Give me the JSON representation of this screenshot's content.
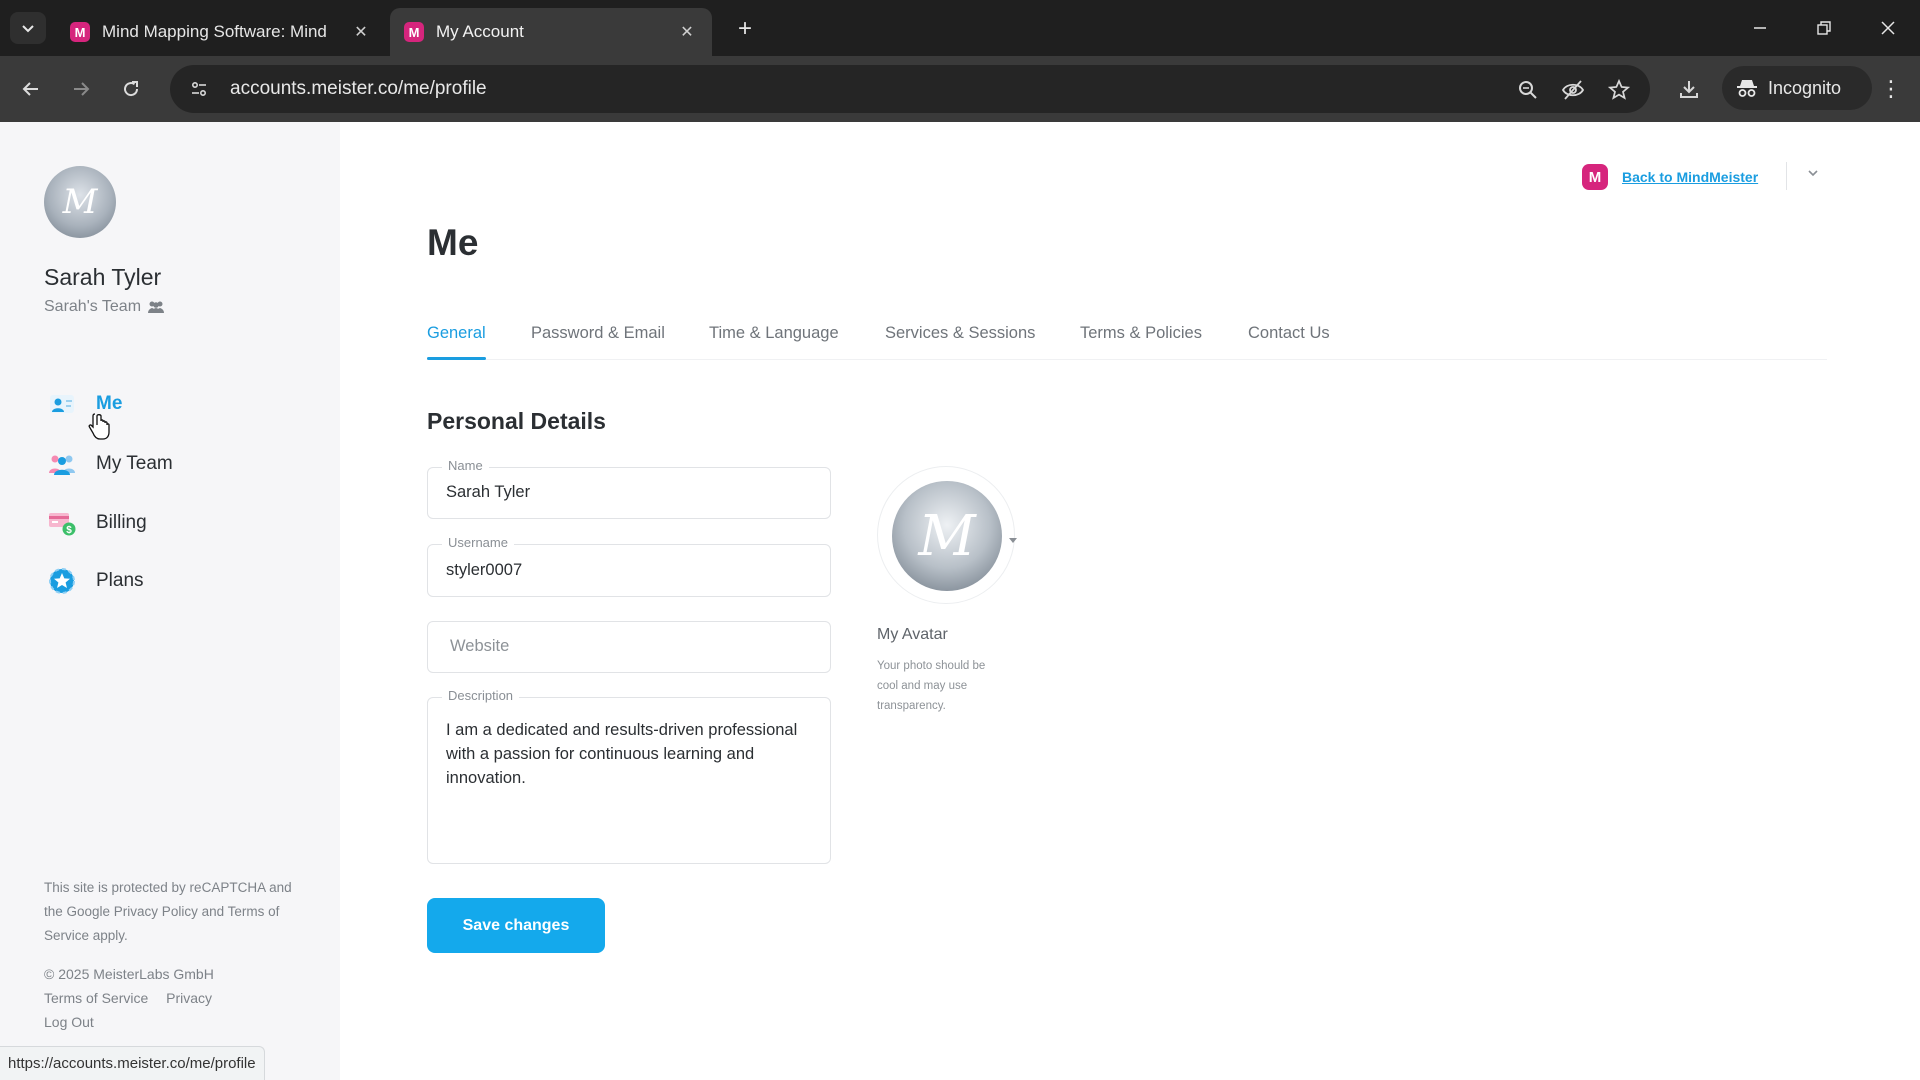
{
  "browser": {
    "tabs": [
      {
        "title": "Mind Mapping Software: Mind",
        "favicon": "M",
        "active": false
      },
      {
        "title": "My Account",
        "favicon": "M",
        "active": true
      }
    ],
    "url": "accounts.meister.co/me/profile",
    "incognito_label": "Incognito",
    "status_url": "https://accounts.meister.co/me/profile"
  },
  "sidebar": {
    "user_name": "Sarah Tyler",
    "team_name": "Sarah's Team",
    "items": [
      {
        "label": "Me",
        "icon": "user-card-icon",
        "active": true
      },
      {
        "label": "My Team",
        "icon": "team-icon",
        "active": false
      },
      {
        "label": "Billing",
        "icon": "billing-icon",
        "active": false
      },
      {
        "label": "Plans",
        "icon": "plans-icon",
        "active": false
      }
    ],
    "legal": "This site is protected by reCAPTCHA and the Google Privacy Policy and Terms of Service apply.",
    "copyright": "© 2025 MeisterLabs GmbH",
    "links": {
      "terms": "Terms of Service",
      "privacy": "Privacy",
      "logout": "Log Out"
    }
  },
  "header": {
    "back_link": "Back to MindMeister",
    "logo_letter": "M"
  },
  "main": {
    "title": "Me",
    "tabs": [
      "General",
      "Password & Email",
      "Time & Language",
      "Services & Sessions",
      "Terms & Policies",
      "Contact Us"
    ],
    "section_title": "Personal Details",
    "fields": {
      "name": {
        "label": "Name",
        "value": "Sarah Tyler"
      },
      "username": {
        "label": "Username",
        "value": "styler0007"
      },
      "website": {
        "placeholder": "Website"
      },
      "description": {
        "label": "Description",
        "value": "I am a dedicated and results-driven professional with a passion for continuous learning and innovation."
      }
    },
    "avatar": {
      "title": "My Avatar",
      "hint": "Your photo should be cool and may use transparency."
    },
    "save_label": "Save changes"
  },
  "colors": {
    "accent": "#1a9de0",
    "button": "#14a9ec",
    "brand": "#d6257d"
  }
}
